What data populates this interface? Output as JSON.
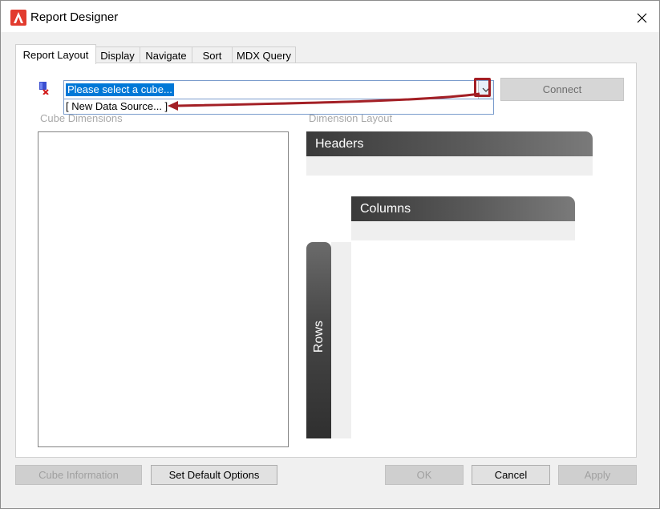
{
  "window": {
    "title": "Report Designer"
  },
  "tabs": [
    {
      "label": "Report Layout",
      "active": true
    },
    {
      "label": "Display",
      "active": false
    },
    {
      "label": "Navigate",
      "active": false
    },
    {
      "label": "Sort",
      "active": false
    },
    {
      "label": "MDX Query",
      "active": false
    }
  ],
  "cube_select": {
    "value": "Please select a cube...",
    "dropdown_items": [
      "[ New Data Source... ]"
    ]
  },
  "connect_label": "Connect",
  "cube_dimensions_label": "Cube Dimensions",
  "dimension_layout_label": "Dimension Layout",
  "zones": {
    "headers": "Headers",
    "columns": "Columns",
    "rows": "Rows"
  },
  "buttons": {
    "cube_information": "Cube Information",
    "set_default_options": "Set Default Options",
    "ok": "OK",
    "cancel": "Cancel",
    "apply": "Apply"
  },
  "colors": {
    "accent_red": "#a31f25",
    "selection_blue": "#0078d7",
    "zone_dark": "#3a3a3a"
  }
}
